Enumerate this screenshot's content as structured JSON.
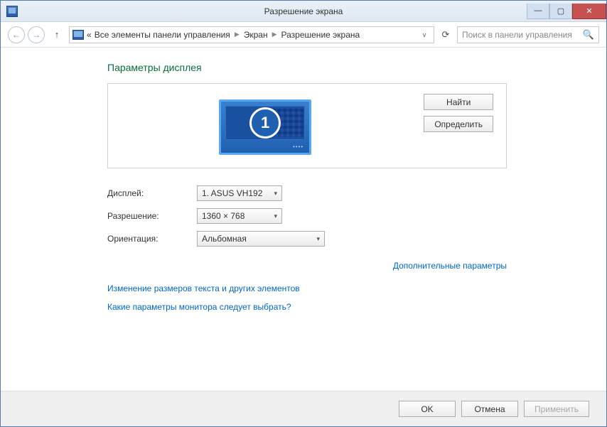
{
  "title": "Разрешение экрана",
  "breadcrumb": {
    "prefix": "«",
    "item1": "Все элементы панели управления",
    "item2": "Экран",
    "item3": "Разрешение экрана"
  },
  "search_placeholder": "Поиск в панели управления",
  "heading": "Параметры дисплея",
  "monitor_number": "1",
  "buttons": {
    "find": "Найти",
    "identify": "Определить",
    "ok": "OK",
    "cancel": "Отмена",
    "apply": "Применить"
  },
  "form": {
    "display_label": "Дисплей:",
    "display_value": "1. ASUS VH192",
    "resolution_label": "Разрешение:",
    "resolution_value": "1360 × 768",
    "orientation_label": "Ориентация:",
    "orientation_value": "Альбомная"
  },
  "links": {
    "advanced": "Дополнительные параметры",
    "text_size": "Изменение размеров текста и других элементов",
    "which_params": "Какие параметры монитора следует выбрать?"
  }
}
